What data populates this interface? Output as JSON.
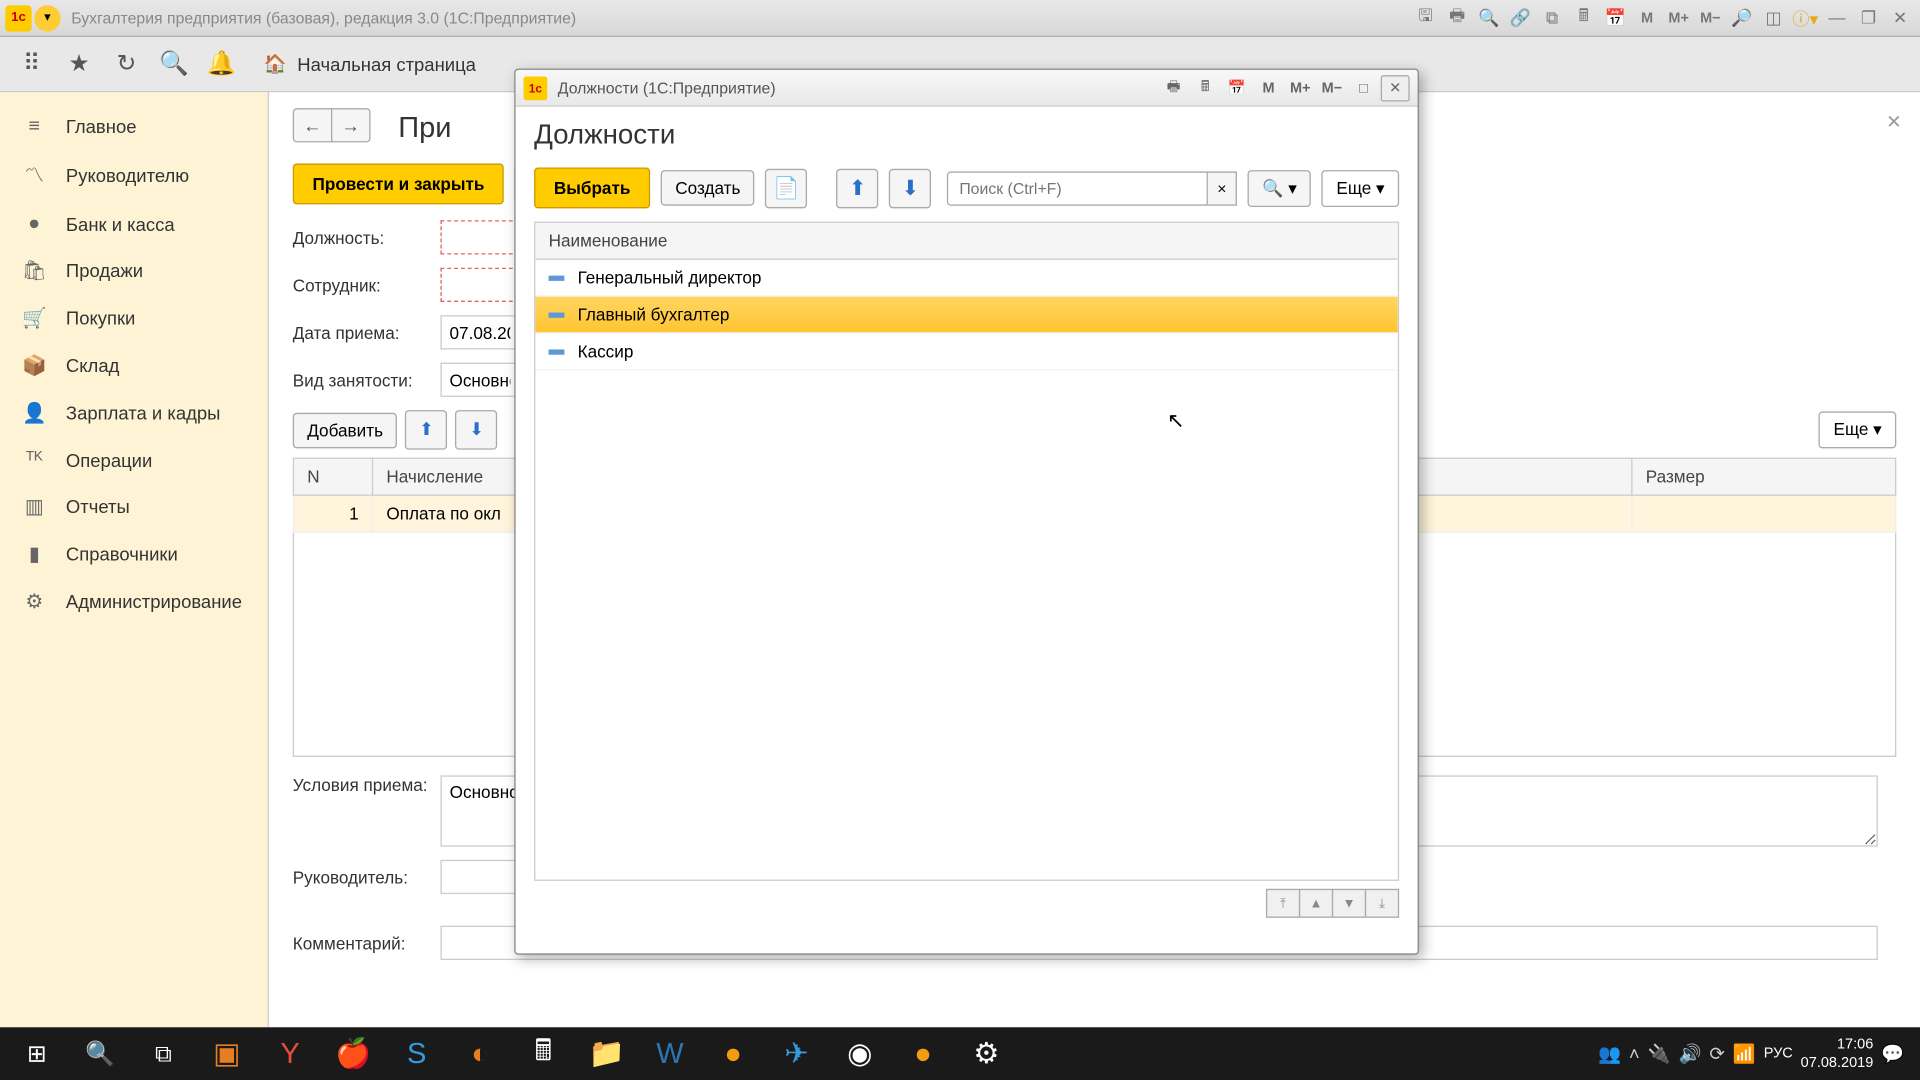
{
  "window_title": "Бухгалтерия предприятия (базовая), редакция 3.0  (1С:Предприятие)",
  "titlebar_right": {
    "m1": "M",
    "m2": "M+",
    "m3": "M−"
  },
  "breadcrumb": {
    "home": "Начальная страница"
  },
  "sidebar": {
    "items": [
      {
        "icon": "≡",
        "label": "Главное"
      },
      {
        "icon": "📈",
        "label": "Руководителю"
      },
      {
        "icon": "●",
        "label": "Банк и касса"
      },
      {
        "icon": "🛍",
        "label": "Продажи"
      },
      {
        "icon": "🛒",
        "label": "Покупки"
      },
      {
        "icon": "📦",
        "label": "Склад"
      },
      {
        "icon": "👤",
        "label": "Зарплата и кадры"
      },
      {
        "icon": "⇅",
        "label": "Операции"
      },
      {
        "icon": "📊",
        "label": "Отчеты"
      },
      {
        "icon": "📚",
        "label": "Справочники"
      },
      {
        "icon": "⚙",
        "label": "Администрирование"
      }
    ]
  },
  "content": {
    "page_title_partial": "При",
    "save_close": "Провести и закрыть",
    "add": "Добавить",
    "more": "Еще",
    "fields": {
      "position": "Должность:",
      "employee": "Сотрудник:",
      "date_hired": "Дата приема:",
      "date_value": "07.08.20",
      "employment_type": "Вид занятости:",
      "employment_value": "Основно",
      "conditions": "Условия приема:",
      "conditions_value": "Основно",
      "manager": "Руководитель:",
      "comment": "Комментарий:"
    },
    "table": {
      "headers": {
        "n": "N",
        "accrual": "Начисление",
        "size": "Размер"
      },
      "rows": [
        {
          "n": "1",
          "accrual": "Оплата по окл"
        }
      ]
    }
  },
  "dialog": {
    "titlebar": "Должности  (1С:Предприятие)",
    "heading": "Должности",
    "select": "Выбрать",
    "create": "Создать",
    "search_placeholder": "Поиск (Ctrl+F)",
    "more": "Еще",
    "column": "Наименование",
    "rows": [
      {
        "label": "Генеральный директор",
        "selected": false
      },
      {
        "label": "Главный бухгалтер",
        "selected": true
      },
      {
        "label": "Кассир",
        "selected": false
      }
    ]
  },
  "taskbar": {
    "lang": "РУС",
    "time": "17:06",
    "date": "07.08.2019"
  }
}
